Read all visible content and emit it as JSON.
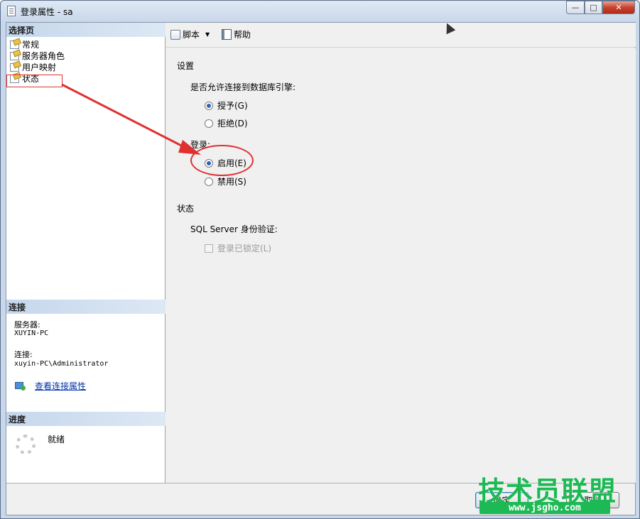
{
  "window": {
    "title": "登录属性 - sa",
    "minimize_label": "—",
    "maximize_label": "□",
    "close_label": "✕"
  },
  "left_pane": {
    "select_page_header": "选择页",
    "pages": [
      {
        "label": "常规"
      },
      {
        "label": "服务器角色"
      },
      {
        "label": "用户映射"
      },
      {
        "label": "状态"
      }
    ],
    "connection_header": "连接",
    "server_label": "服务器:",
    "server_value": "XUYIN-PC",
    "connection_label": "连接:",
    "connection_value": "xuyin-PC\\Administrator",
    "view_connection_link": "查看连接属性",
    "progress_header": "进度",
    "progress_status": "就绪"
  },
  "toolbar": {
    "script_label": "脚本",
    "caret": "▼",
    "help_label": "帮助"
  },
  "settings": {
    "settings_title": "设置",
    "db_engine_question": "是否允许连接到数据库引擎:",
    "grant_label": "授予(G)",
    "deny_label": "拒绝(D)",
    "login_title": "登录:",
    "enabled_label": "启用(E)",
    "disabled_label": "禁用(S)",
    "grant_selected": true,
    "enabled_selected": true
  },
  "status": {
    "status_title": "状态",
    "sql_auth_label": "SQL Server 身份验证:",
    "locked_label": "登录已锁定(L)"
  },
  "bottom": {
    "ok_label": "确定",
    "cancel_label": "取消"
  },
  "watermark": {
    "main": "技术员联盟",
    "site": "www.jsgho.com"
  },
  "colors": {
    "annotation_red": "#e03030",
    "watermark_green": "#1db954",
    "link_blue": "#0033aa"
  }
}
